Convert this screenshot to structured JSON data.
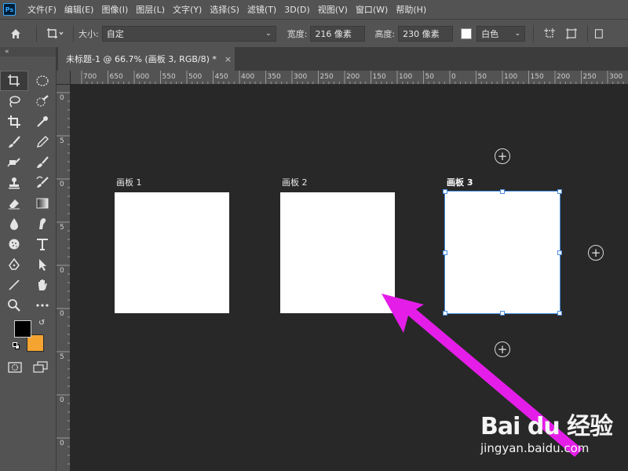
{
  "app": {
    "logo_text": "Ps",
    "menu": [
      "文件(F)",
      "编辑(E)",
      "图像(I)",
      "图层(L)",
      "文字(Y)",
      "选择(S)",
      "滤镜(T)",
      "3D(D)",
      "视图(V)",
      "窗口(W)",
      "帮助(H)"
    ]
  },
  "options": {
    "size_label": "大小:",
    "size_value": "自定",
    "width_label": "宽度:",
    "width_value": "216 像素",
    "height_label": "高度:",
    "height_value": "230 像素",
    "color_value": "白色",
    "color_swatch": "#ffffff"
  },
  "tools": {
    "collapse_label": "«",
    "items": [
      "artboard-tool",
      "elliptical-marquee-tool",
      "lasso-tool",
      "quick-selection-tool",
      "crop-tool",
      "eyedropper-tool",
      "healing-brush-tool",
      "pencil-tool",
      "clone-stamp-tool",
      "mixer-brush-tool",
      "history-brush-tool",
      "art-history-brush-tool",
      "eraser-tool",
      "gradient-tool",
      "blur-tool",
      "smudge-tool",
      "sponge-tool",
      "type-tool",
      "pen-tool",
      "path-selection-tool",
      "line-tool",
      "hand-tool",
      "zoom-tool",
      "more-tools",
      "quick-mask-tool",
      "screen-mode-tool"
    ],
    "foreground_color": "#000000",
    "background_color": "#f5a431"
  },
  "document": {
    "tab_title": "未标题-1 @ 66.7% (画板 3, RGB/8) *",
    "close_label": "×"
  },
  "ruler": {
    "h_ticks": [
      "700",
      "650",
      "600",
      "550",
      "500",
      "450",
      "400",
      "350",
      "300",
      "250",
      "200",
      "150",
      "100",
      "50",
      "0",
      "50",
      "100",
      "150",
      "200",
      "250",
      "300"
    ],
    "v_ticks": [
      "0",
      "5",
      "0",
      "5",
      "0",
      "0",
      "5",
      "0",
      "0"
    ]
  },
  "artboards": [
    {
      "label": "画板 1",
      "selected": false
    },
    {
      "label": "画板 2",
      "selected": false
    },
    {
      "label": "画板 3",
      "selected": true
    }
  ],
  "add_artboard_symbol": "+",
  "annotation": {
    "arrow_color": "#e41ee8"
  },
  "watermark": {
    "main": "Bai du 经验",
    "sub": "jingyan.baidu.com"
  }
}
